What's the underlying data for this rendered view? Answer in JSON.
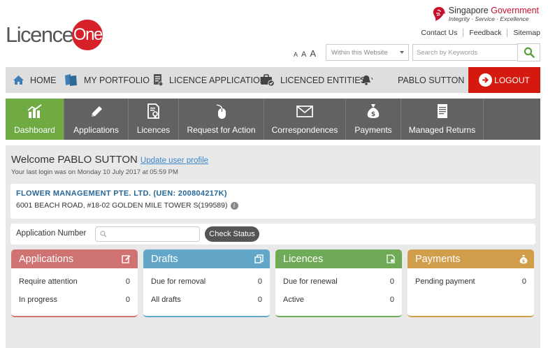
{
  "header": {
    "logo_text": "Licence",
    "logo_circle": "One",
    "gov_title_1": "Singapore",
    "gov_title_2": "Government",
    "gov_tagline": "Integrity · Service · Excellence",
    "links": [
      "Contact Us",
      "Feedback",
      "Sitemap"
    ],
    "font_sizes": [
      "A",
      "A",
      "A"
    ],
    "search_scope": "Within this Website",
    "search_placeholder": "Search by Keywords"
  },
  "nav": {
    "home": "HOME",
    "portfolio": "MY PORTFOLIO",
    "licence_application": "LICENCE APPLICATION",
    "licenced_entities": "LICENCED ENTITIES",
    "user": "PABLO SUTTON",
    "logout": "LOGOUT"
  },
  "tabs": [
    {
      "label": "Dashboard",
      "icon": "chart-icon"
    },
    {
      "label": "Applications",
      "icon": "pencil-icon"
    },
    {
      "label": "Licences",
      "icon": "certificate-icon"
    },
    {
      "label": "Request for Action",
      "icon": "mouse-icon"
    },
    {
      "label": "Correspondences",
      "icon": "envelope-icon"
    },
    {
      "label": "Payments",
      "icon": "money-bag-icon"
    },
    {
      "label": "Managed Returns",
      "icon": "document-icon"
    }
  ],
  "welcome": {
    "greeting": "Welcome PABLO SUTTON",
    "update_link": "Update user profile",
    "last_login": "Your last login was on Monday 10 July 2017 at 05:59 PM"
  },
  "company": {
    "name": "FLOWER MANAGEMENT PTE. LTD. (UEN: 200804217K)",
    "address": "6001 BEACH ROAD, #18-02 GOLDEN MILE TOWER S(199589)"
  },
  "app_check": {
    "label": "Application Number",
    "value": "",
    "button": "Check Status"
  },
  "colors": {
    "applications": "#cf7272",
    "drafts": "#63a7c8",
    "licences": "#6faa57",
    "payments": "#d19f4c",
    "logout": "#d5190f",
    "active_tab": "#6faa43"
  },
  "cards": [
    {
      "title": "Applications",
      "rows": [
        {
          "label": "Require attention",
          "value": "0"
        },
        {
          "label": "In progress",
          "value": "0"
        }
      ]
    },
    {
      "title": "Drafts",
      "rows": [
        {
          "label": "Due for removal",
          "value": "0"
        },
        {
          "label": "All drafts",
          "value": "0"
        }
      ]
    },
    {
      "title": "Licences",
      "rows": [
        {
          "label": "Due for renewal",
          "value": "0"
        },
        {
          "label": "Active",
          "value": "0"
        }
      ]
    },
    {
      "title": "Payments",
      "rows": [
        {
          "label": "Pending payment",
          "value": "0"
        }
      ]
    }
  ]
}
